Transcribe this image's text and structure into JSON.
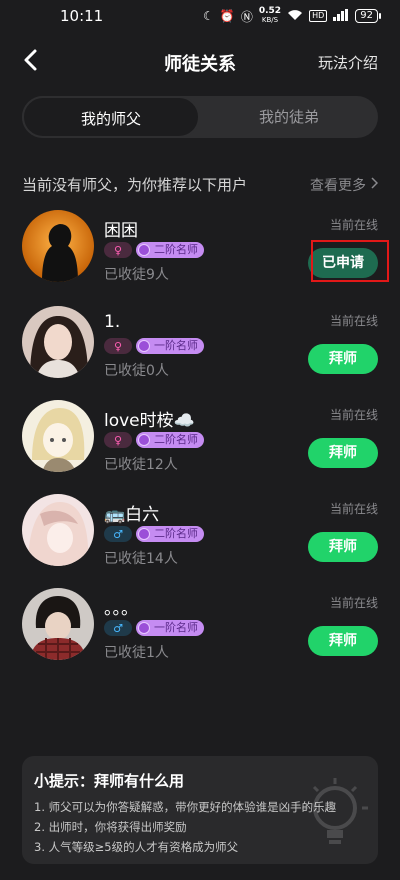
{
  "status_bar": {
    "time": "10:11",
    "net_speed": "0.52",
    "net_unit": "KB/S",
    "hd": "HD",
    "battery": "92"
  },
  "header": {
    "title": "师徒关系",
    "rules_link": "玩法介绍"
  },
  "tabs": [
    {
      "label": "我的师父",
      "active": true
    },
    {
      "label": "我的徒弟",
      "active": false
    }
  ],
  "section": {
    "title": "当前没有师父，为你推荐以下用户",
    "see_more": "查看更多"
  },
  "users": [
    {
      "name": "困困",
      "gender": "female",
      "gender_symbol": "♀",
      "level": "二阶名师",
      "disciples": "已收徒9人",
      "status": "当前在线",
      "action": "已申请",
      "applied": true
    },
    {
      "name": "1.",
      "gender": "female",
      "gender_symbol": "♀",
      "level": "一阶名师",
      "disciples": "已收徒0人",
      "status": "当前在线",
      "action": "拜师",
      "applied": false
    },
    {
      "name": "love时桉☁️",
      "gender": "female",
      "gender_symbol": "♀",
      "level": "二阶名师",
      "disciples": "已收徒12人",
      "status": "当前在线",
      "action": "拜师",
      "applied": false
    },
    {
      "name": "🚌白六",
      "gender": "male",
      "gender_symbol": "♂",
      "level": "二阶名师",
      "disciples": "已收徒14人",
      "status": "当前在线",
      "action": "拜师",
      "applied": false
    },
    {
      "name": "。。。",
      "gender": "male",
      "gender_symbol": "♂",
      "level": "一阶名师",
      "disciples": "已收徒1人",
      "status": "当前在线",
      "action": "拜师",
      "applied": false
    }
  ],
  "tips": {
    "title": "小提示：拜师有什么用",
    "lines": [
      "1. 师父可以为你答疑解惑，带你更好的体验谁是凶手的乐趣",
      "2. 出师时，你将获得出师奖励",
      "3. 人气等级≥5级的人才有资格成为师父"
    ]
  },
  "colors": {
    "background": "#1c1c1e",
    "accent_green": "#21d36a",
    "applied_green": "#1e6b50",
    "level_badge": "#c58cf2",
    "female": "#ff5fb3",
    "male": "#48b8ff",
    "highlight": "#e21818"
  }
}
